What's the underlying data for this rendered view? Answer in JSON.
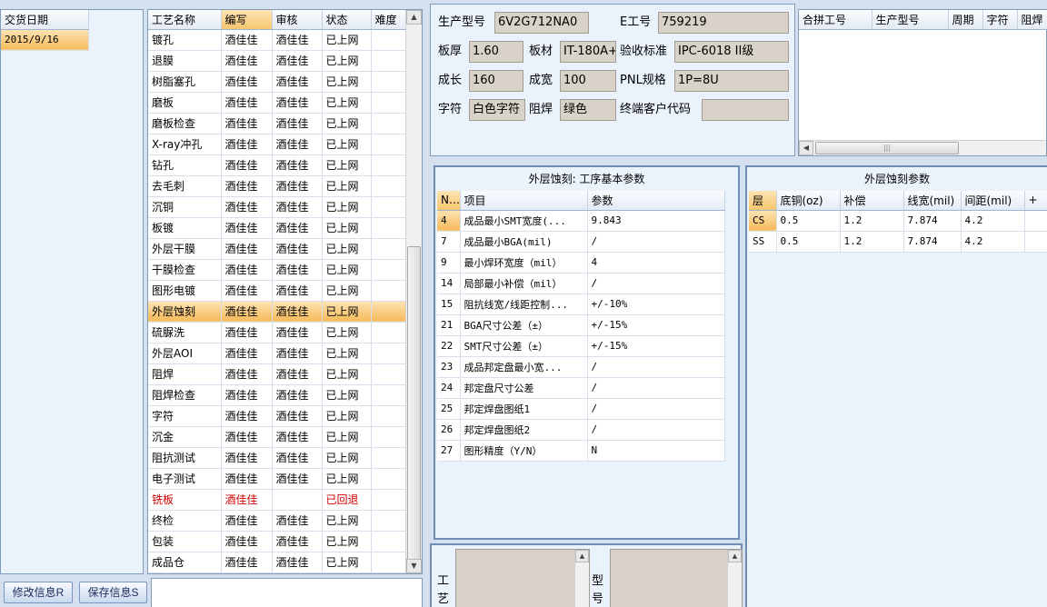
{
  "date_panel": {
    "header": "交货日期",
    "value": "2015/9/16"
  },
  "process_grid": {
    "headers": [
      "工艺名称",
      "编写",
      "审核",
      "状态",
      "难度"
    ],
    "rows": [
      [
        "镀孔",
        "酒佳佳",
        "酒佳佳",
        "已上网",
        ""
      ],
      [
        "退膜",
        "酒佳佳",
        "酒佳佳",
        "已上网",
        ""
      ],
      [
        "树脂塞孔",
        "酒佳佳",
        "酒佳佳",
        "已上网",
        ""
      ],
      [
        "磨板",
        "酒佳佳",
        "酒佳佳",
        "已上网",
        ""
      ],
      [
        "磨板检查",
        "酒佳佳",
        "酒佳佳",
        "已上网",
        ""
      ],
      [
        "X-ray冲孔",
        "酒佳佳",
        "酒佳佳",
        "已上网",
        ""
      ],
      [
        "钻孔",
        "酒佳佳",
        "酒佳佳",
        "已上网",
        ""
      ],
      [
        "去毛刺",
        "酒佳佳",
        "酒佳佳",
        "已上网",
        ""
      ],
      [
        "沉铜",
        "酒佳佳",
        "酒佳佳",
        "已上网",
        ""
      ],
      [
        "板镀",
        "酒佳佳",
        "酒佳佳",
        "已上网",
        ""
      ],
      [
        "外层干膜",
        "酒佳佳",
        "酒佳佳",
        "已上网",
        ""
      ],
      [
        "干膜检查",
        "酒佳佳",
        "酒佳佳",
        "已上网",
        ""
      ],
      [
        "图形电镀",
        "酒佳佳",
        "酒佳佳",
        "已上网",
        ""
      ],
      [
        "外层蚀刻",
        "酒佳佳",
        "酒佳佳",
        "已上网",
        ""
      ],
      [
        "硫脲洗",
        "酒佳佳",
        "酒佳佳",
        "已上网",
        ""
      ],
      [
        "外层AOI",
        "酒佳佳",
        "酒佳佳",
        "已上网",
        ""
      ],
      [
        "阻焊",
        "酒佳佳",
        "酒佳佳",
        "已上网",
        ""
      ],
      [
        "阻焊检查",
        "酒佳佳",
        "酒佳佳",
        "已上网",
        ""
      ],
      [
        "字符",
        "酒佳佳",
        "酒佳佳",
        "已上网",
        ""
      ],
      [
        "沉金",
        "酒佳佳",
        "酒佳佳",
        "已上网",
        ""
      ],
      [
        "阻抗测试",
        "酒佳佳",
        "酒佳佳",
        "已上网",
        ""
      ],
      [
        "电子测试",
        "酒佳佳",
        "酒佳佳",
        "已上网",
        ""
      ],
      [
        "铣板",
        "酒佳佳",
        "",
        "已回退",
        ""
      ],
      [
        "终检",
        "酒佳佳",
        "酒佳佳",
        "已上网",
        ""
      ],
      [
        "包装",
        "酒佳佳",
        "酒佳佳",
        "已上网",
        ""
      ],
      [
        "成品仓",
        "酒佳佳",
        "酒佳佳",
        "已上网",
        ""
      ]
    ],
    "selected_row": 13,
    "returned_row": 22
  },
  "buttons": {
    "modify": "修改信息R",
    "save": "保存信息S"
  },
  "product_info": {
    "model_label": "生产型号",
    "model_value": "6V2G712NA0",
    "e_label": "E工号",
    "e_value": "759219",
    "thickness_label": "板厚",
    "thickness_value": "1.60",
    "material_label": "板材",
    "material_value": "IT-180A+",
    "standard_label": "验收标准",
    "standard_value": "IPC-6018 II级",
    "length_label": "成长",
    "length_value": "160",
    "width_label": "成宽",
    "width_value": "100",
    "pnl_label": "PNL规格",
    "pnl_value": "1P=8U",
    "char_label": "字符",
    "char_value": "白色字符",
    "mask_label": "阻焊",
    "mask_value": "绿色",
    "customer_label": "终端客户代码",
    "customer_value": ""
  },
  "combine_grid": {
    "headers": [
      "合拼工号",
      "生产型号",
      "周期",
      "字符",
      "阻焊"
    ]
  },
  "basic_params": {
    "title": "外层蚀刻: 工序基本参数",
    "headers": [
      "NO",
      "项目",
      "参数"
    ],
    "rows": [
      [
        "4",
        "成品最小SMT宽度(...",
        "9.843"
      ],
      [
        "7",
        "成品最小BGA(mil)",
        "/"
      ],
      [
        "9",
        "最小焊环宽度（mil）",
        "4"
      ],
      [
        "14",
        "局部最小补偿（mil）",
        "/"
      ],
      [
        "15",
        "阻抗线宽/线距控制...",
        "+/-10%"
      ],
      [
        "21",
        "BGA尺寸公差（±）",
        "+/-15%"
      ],
      [
        "22",
        "SMT尺寸公差（±）",
        "+/-15%"
      ],
      [
        "23",
        "成品邦定盘最小宽...",
        "/"
      ],
      [
        "24",
        "邦定盘尺寸公差",
        "/"
      ],
      [
        "25",
        "邦定焊盘图纸1",
        "/"
      ],
      [
        "26",
        "邦定焊盘图纸2",
        "/"
      ],
      [
        "27",
        "图形精度（Y/N）",
        "N"
      ]
    ]
  },
  "etch_params": {
    "title": "外层蚀刻参数",
    "headers": [
      "层",
      "底铜(oz)",
      "补偿",
      "线宽(mil)",
      "间距(mil)",
      "+"
    ],
    "rows": [
      [
        "CS",
        "0.5",
        "1.2",
        "7.874",
        "4.2",
        ""
      ],
      [
        "SS",
        "0.5",
        "1.2",
        "7.874",
        "4.2",
        ""
      ]
    ]
  },
  "bottom_labels": {
    "craft_1": "工",
    "craft_2": "艺",
    "model_1": "型",
    "model_2": "号"
  }
}
